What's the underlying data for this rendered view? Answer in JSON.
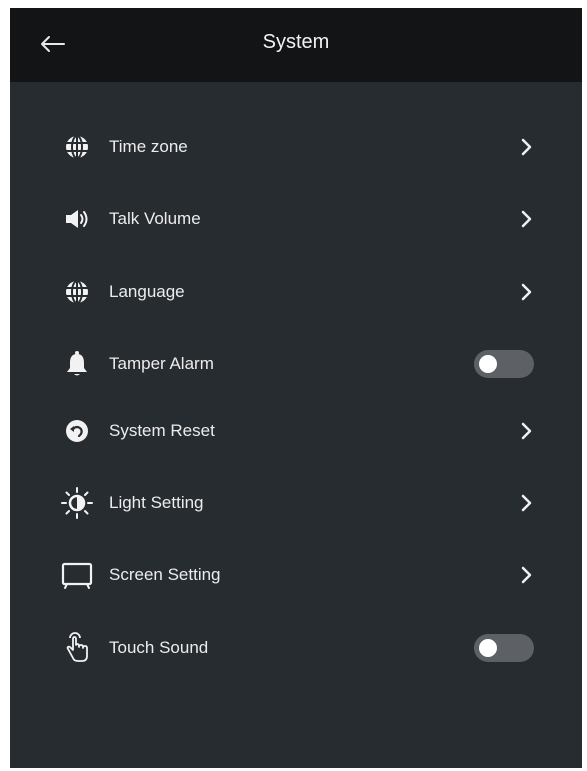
{
  "header": {
    "title": "System",
    "back_icon": "arrow-left-icon"
  },
  "settings": [
    {
      "label": "Time zone",
      "icon": "globe-icon",
      "control": "chevron"
    },
    {
      "label": "Talk Volume",
      "icon": "speaker-icon",
      "control": "chevron"
    },
    {
      "label": "Language",
      "icon": "globe-icon",
      "control": "chevron"
    },
    {
      "label": "Tamper Alarm",
      "icon": "bell-icon",
      "control": "toggle",
      "enabled": false
    },
    {
      "label": "System Reset",
      "icon": "reset-icon",
      "control": "chevron"
    },
    {
      "label": "Light Setting",
      "icon": "light-icon",
      "control": "chevron"
    },
    {
      "label": "Screen Setting",
      "icon": "monitor-icon",
      "control": "chevron"
    },
    {
      "label": "Touch Sound",
      "icon": "touch-icon",
      "control": "toggle",
      "enabled": false
    }
  ],
  "colors": {
    "background": "#272c31",
    "header_background": "#121416",
    "text": "#ececec",
    "toggle_off": "#5d6166"
  }
}
